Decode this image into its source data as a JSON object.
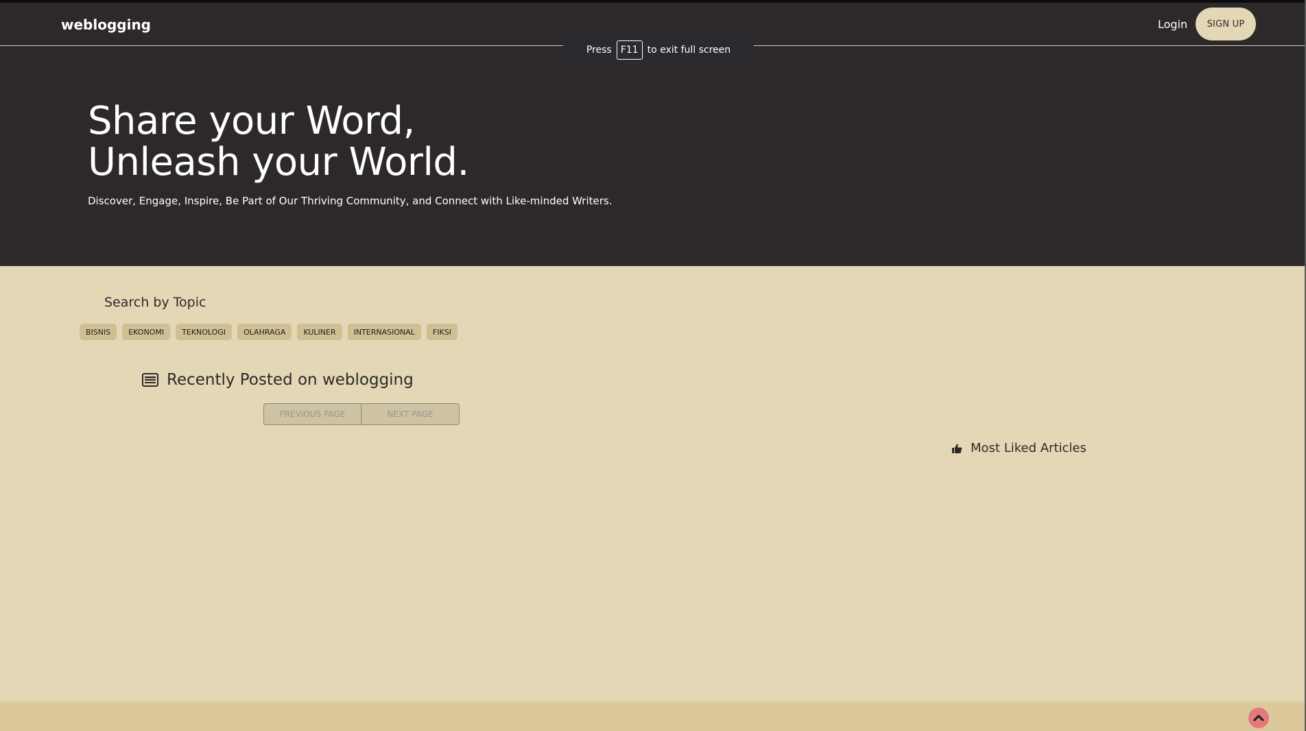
{
  "nav": {
    "brand": "weblogging",
    "login_label": "Login",
    "signup_label": "SIGN UP"
  },
  "fullscreen_notice": {
    "before": "Press",
    "key": "F11",
    "after": "to exit full screen"
  },
  "hero": {
    "title_line1": "Share your Word,",
    "title_line2": "Unleash your World.",
    "subtitle": "Discover, Engage, Inspire, Be Part of Our Thriving Community, and Connect with Like-minded Writers."
  },
  "topics": {
    "heading": "Search by Topic",
    "items": [
      "BISNIS",
      "EKONOMI",
      "TEKNOLOGI",
      "OLAHRAGA",
      "KULINER",
      "INTERNASIONAL",
      "FIKSI"
    ]
  },
  "recent": {
    "icon": "newspaper-icon",
    "title": "Recently Posted on weblogging",
    "previous_label": "PREVIOUS PAGE",
    "next_label": "NEXT PAGE"
  },
  "most_liked": {
    "icon": "thumbs-up-icon",
    "title": "Most Liked Articles"
  },
  "scroll_top": {
    "icon": "chevron-up-icon"
  },
  "colors": {
    "dark": "#2d292b",
    "cream": "#e3d7b5",
    "chip": "#cfbf93",
    "footer": "#dcc99b",
    "scroll_top": "#e4787c"
  }
}
